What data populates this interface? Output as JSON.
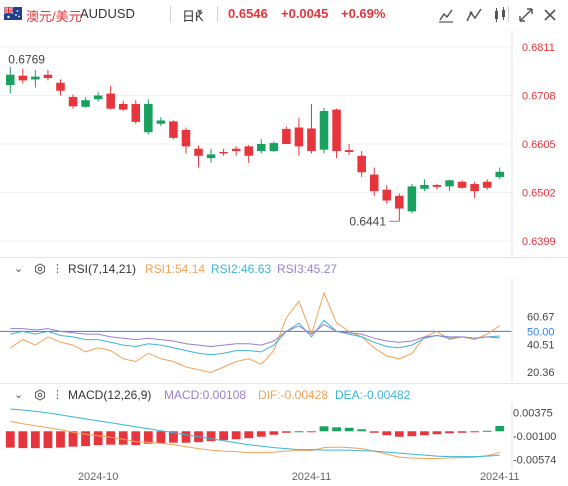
{
  "header": {
    "name": "澳元/美元",
    "code": "AUDUSD",
    "period": "日K",
    "price": "0.6546",
    "change": "+0.0045",
    "change_pct": "+0.69%"
  },
  "colors": {
    "up": "#e6353c",
    "down": "#19a15f",
    "rsi1": "#f4a259",
    "rsi2": "#3cb5d6",
    "rsi3": "#9a7fd1",
    "macd_line": "#f4a259",
    "dea_line": "#3cb5d6",
    "ref_line": "#2f7ff0"
  },
  "icons": [
    "flag-icon",
    "dropdown-arrow-icon",
    "draw-icon",
    "indicator-icon",
    "compare-icon",
    "expand-icon",
    "close-icon",
    "settings-icon"
  ],
  "chart_data": [
    {
      "type": "candlestick",
      "ylim": [
        0.638,
        0.683
      ],
      "yticks": [
        "0.6811",
        "0.6708",
        "0.6605",
        "0.6502",
        "0.6399"
      ],
      "xticks": [
        {
          "label": "2024-10",
          "index": 7
        },
        {
          "label": "2024-11",
          "index": 24
        },
        {
          "label": "2024-11",
          "index": 39
        }
      ],
      "annotations": [
        {
          "text": "0.6769",
          "index": 0,
          "value": 0.6769
        },
        {
          "text": "0.6441",
          "index": 31,
          "value": 0.6441
        }
      ],
      "candles": [
        {
          "o": 0.673,
          "h": 0.6769,
          "l": 0.6712,
          "c": 0.6752
        },
        {
          "o": 0.675,
          "h": 0.6765,
          "l": 0.6733,
          "c": 0.674
        },
        {
          "o": 0.6742,
          "h": 0.6762,
          "l": 0.6725,
          "c": 0.6748
        },
        {
          "o": 0.6752,
          "h": 0.6762,
          "l": 0.674,
          "c": 0.6745
        },
        {
          "o": 0.6735,
          "h": 0.6742,
          "l": 0.6708,
          "c": 0.6718
        },
        {
          "o": 0.6705,
          "h": 0.671,
          "l": 0.668,
          "c": 0.6685
        },
        {
          "o": 0.6684,
          "h": 0.6704,
          "l": 0.6682,
          "c": 0.6698
        },
        {
          "o": 0.67,
          "h": 0.6715,
          "l": 0.6695,
          "c": 0.6708
        },
        {
          "o": 0.6712,
          "h": 0.6728,
          "l": 0.6678,
          "c": 0.668
        },
        {
          "o": 0.669,
          "h": 0.6697,
          "l": 0.6675,
          "c": 0.6678
        },
        {
          "o": 0.669,
          "h": 0.6698,
          "l": 0.6648,
          "c": 0.6652
        },
        {
          "o": 0.663,
          "h": 0.67,
          "l": 0.6625,
          "c": 0.669
        },
        {
          "o": 0.6648,
          "h": 0.6662,
          "l": 0.6643,
          "c": 0.6655
        },
        {
          "o": 0.6653,
          "h": 0.6655,
          "l": 0.6615,
          "c": 0.6618
        },
        {
          "o": 0.6635,
          "h": 0.664,
          "l": 0.6585,
          "c": 0.66
        },
        {
          "o": 0.6595,
          "h": 0.6602,
          "l": 0.6555,
          "c": 0.658
        },
        {
          "o": 0.6575,
          "h": 0.6595,
          "l": 0.6565,
          "c": 0.6583
        },
        {
          "o": 0.6588,
          "h": 0.6595,
          "l": 0.658,
          "c": 0.6585
        },
        {
          "o": 0.6595,
          "h": 0.66,
          "l": 0.658,
          "c": 0.659
        },
        {
          "o": 0.66,
          "h": 0.6603,
          "l": 0.6565,
          "c": 0.658
        },
        {
          "o": 0.659,
          "h": 0.6615,
          "l": 0.6585,
          "c": 0.6605
        },
        {
          "o": 0.659,
          "h": 0.661,
          "l": 0.6588,
          "c": 0.6607
        },
        {
          "o": 0.6637,
          "h": 0.6642,
          "l": 0.6605,
          "c": 0.6605
        },
        {
          "o": 0.664,
          "h": 0.666,
          "l": 0.658,
          "c": 0.66
        },
        {
          "o": 0.6638,
          "h": 0.669,
          "l": 0.6585,
          "c": 0.659
        },
        {
          "o": 0.6593,
          "h": 0.6682,
          "l": 0.6585,
          "c": 0.6675
        },
        {
          "o": 0.6678,
          "h": 0.668,
          "l": 0.6575,
          "c": 0.659
        },
        {
          "o": 0.6592,
          "h": 0.6605,
          "l": 0.6582,
          "c": 0.6588
        },
        {
          "o": 0.658,
          "h": 0.659,
          "l": 0.6535,
          "c": 0.6545
        },
        {
          "o": 0.654,
          "h": 0.6555,
          "l": 0.6495,
          "c": 0.6505
        },
        {
          "o": 0.6508,
          "h": 0.6518,
          "l": 0.6478,
          "c": 0.6485
        },
        {
          "o": 0.6495,
          "h": 0.65,
          "l": 0.6441,
          "c": 0.6468
        },
        {
          "o": 0.6462,
          "h": 0.652,
          "l": 0.6458,
          "c": 0.6515
        },
        {
          "o": 0.651,
          "h": 0.653,
          "l": 0.6505,
          "c": 0.6518
        },
        {
          "o": 0.6518,
          "h": 0.652,
          "l": 0.6508,
          "c": 0.6514
        },
        {
          "o": 0.6515,
          "h": 0.653,
          "l": 0.6505,
          "c": 0.6528
        },
        {
          "o": 0.6525,
          "h": 0.6528,
          "l": 0.651,
          "c": 0.6512
        },
        {
          "o": 0.652,
          "h": 0.6525,
          "l": 0.649,
          "c": 0.6505
        },
        {
          "o": 0.6525,
          "h": 0.653,
          "l": 0.6508,
          "c": 0.6512
        },
        {
          "o": 0.6535,
          "h": 0.6555,
          "l": 0.653,
          "c": 0.6546
        }
      ]
    },
    {
      "type": "line",
      "name": "RSI",
      "params": "RSI(7,14,21)",
      "ylim": [
        16,
        86
      ],
      "yticks": [
        "60.67",
        "50.00",
        "40.51",
        "20.36"
      ],
      "ref_value": 50,
      "legend": [
        {
          "label": "RSI1:54.14"
        },
        {
          "label": "RSI2:46.63"
        },
        {
          "label": "RSI3:45.27"
        }
      ],
      "series": [
        {
          "name": "RSI1",
          "values": [
            38,
            44,
            40,
            46,
            42,
            40,
            35,
            38,
            36,
            30,
            28,
            34,
            30,
            28,
            24,
            22,
            20,
            24,
            28,
            30,
            26,
            36,
            60,
            72,
            48,
            78,
            56,
            50,
            46,
            38,
            32,
            30,
            34,
            46,
            50,
            44,
            46,
            44,
            48,
            54.14
          ]
        },
        {
          "name": "RSI2",
          "values": [
            48,
            50,
            48,
            50,
            47,
            46,
            44,
            44,
            42,
            40,
            39,
            41,
            40,
            38,
            36,
            34,
            33,
            34,
            36,
            36,
            35,
            40,
            50,
            56,
            46,
            58,
            50,
            48,
            46,
            42,
            39,
            38,
            40,
            45,
            47,
            45,
            46,
            45,
            46,
            46.63
          ]
        },
        {
          "name": "RSI3",
          "values": [
            52,
            52,
            51,
            52,
            50,
            49,
            48,
            48,
            46,
            45,
            44,
            45,
            44,
            43,
            41,
            40,
            39,
            40,
            41,
            41,
            40,
            43,
            50,
            54,
            48,
            55,
            50,
            49,
            48,
            45,
            43,
            42,
            43,
            46,
            47,
            46,
            46,
            45,
            46,
            45.27
          ]
        }
      ]
    },
    {
      "type": "bar",
      "name": "MACD",
      "params": "MACD(12,26,9)",
      "ylim": [
        -0.0066,
        0.0055
      ],
      "yticks": [
        "0.00375",
        "-0.00100",
        "-0.00574"
      ],
      "legend": [
        {
          "label": "MACD:0.00108"
        },
        {
          "label": "DIF:-0.00428"
        },
        {
          "label": "DEA:-0.00482"
        }
      ],
      "values": [
        -0.0033,
        -0.0034,
        -0.0034,
        -0.0034,
        -0.0033,
        -0.0031,
        -0.003,
        -0.0028,
        -0.0027,
        -0.0027,
        -0.0028,
        -0.0025,
        -0.0024,
        -0.0023,
        -0.0023,
        -0.0022,
        -0.002,
        -0.0018,
        -0.0016,
        -0.0014,
        -0.0011,
        -0.0007,
        -0.0003,
        0.0,
        -0.0002,
        0.001,
        0.0008,
        0.0007,
        0.0004,
        -0.0003,
        -0.0008,
        -0.0011,
        -0.001,
        -0.0008,
        -0.0006,
        -0.0004,
        -0.0003,
        -0.0002,
        0.0001,
        0.00108
      ],
      "series": [
        {
          "name": "DIF",
          "values": [
            0.002,
            0.0015,
            0.0011,
            0.0007,
            0.0003,
            -0.0002,
            -0.0006,
            -0.0009,
            -0.0012,
            -0.0016,
            -0.0021,
            -0.0022,
            -0.0024,
            -0.0027,
            -0.0031,
            -0.0035,
            -0.0038,
            -0.004,
            -0.0041,
            -0.0043,
            -0.0043,
            -0.0042,
            -0.004,
            -0.0038,
            -0.0039,
            -0.0033,
            -0.0032,
            -0.0033,
            -0.0035,
            -0.004,
            -0.0046,
            -0.0052,
            -0.0054,
            -0.0055,
            -0.0055,
            -0.0054,
            -0.0053,
            -0.0052,
            -0.0049,
            -0.00428
          ]
        },
        {
          "name": "DEA",
          "values": [
            0.0045,
            0.0043,
            0.004,
            0.0037,
            0.0033,
            0.0029,
            0.0025,
            0.0021,
            0.0017,
            0.0013,
            0.0009,
            0.0005,
            0.0001,
            -0.0003,
            -0.0007,
            -0.0011,
            -0.0015,
            -0.0019,
            -0.0023,
            -0.0027,
            -0.003,
            -0.0033,
            -0.0035,
            -0.0037,
            -0.0037,
            -0.0038,
            -0.0038,
            -0.0038,
            -0.0039,
            -0.004,
            -0.0042,
            -0.0044,
            -0.0046,
            -0.0048,
            -0.005,
            -0.0051,
            -0.0051,
            -0.0051,
            -0.005,
            -0.00482
          ]
        }
      ]
    }
  ]
}
